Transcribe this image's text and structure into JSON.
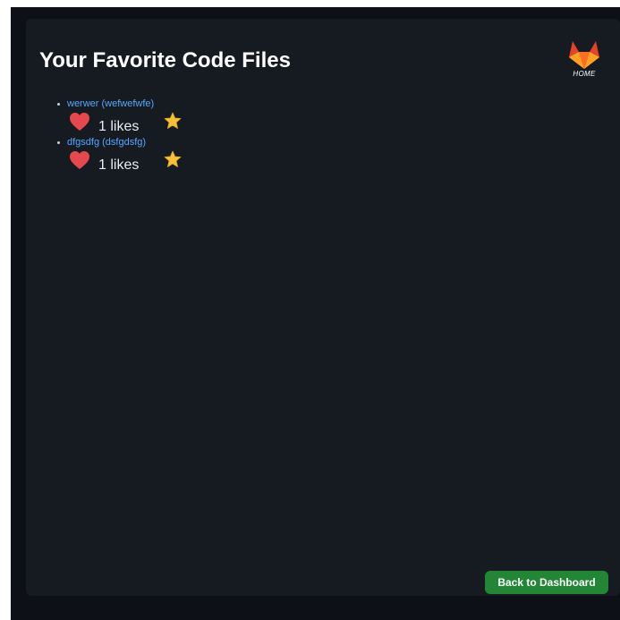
{
  "page": {
    "title": "Your Favorite Code Files"
  },
  "header": {
    "home_label": "HOME",
    "logo_icon": "gitlab-fox-logo-icon"
  },
  "favorites": [
    {
      "link_text": "werwer (wefwefwfe)",
      "likes_text": "1 likes",
      "like_icon": "heart-icon",
      "favorite_icon": "star-icon"
    },
    {
      "link_text": "dfgsdfg (dsfgdsfg)",
      "likes_text": "1 likes",
      "like_icon": "heart-icon",
      "favorite_icon": "star-icon"
    }
  ],
  "actions": {
    "back_label": "Back to Dashboard"
  },
  "colors": {
    "background": "#0d1117",
    "card": "#161b22",
    "link": "#58a6ff",
    "heart": "#e5484d",
    "star": "#f8c135",
    "button": "#238636"
  }
}
